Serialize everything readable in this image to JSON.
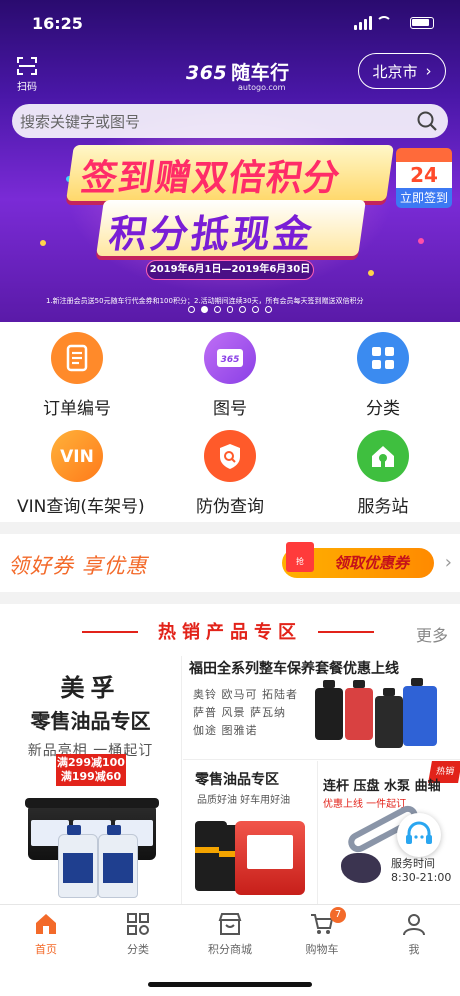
{
  "status_bar": {
    "time": "16:25"
  },
  "header": {
    "scan_label": "扫码",
    "logo_brand": "365",
    "logo_name": "随车行",
    "logo_domain": "autogo.com",
    "city": "北京市",
    "city_arrow": "›"
  },
  "search": {
    "placeholder": "搜索关键字或图号"
  },
  "banner": {
    "title_line1": "签到赠双倍积分",
    "title_line2": "积分抵现金",
    "calendar_day": "24",
    "calendar_button": "立即签到",
    "date_range": "2019年6月1日—2019年6月30日",
    "note": "1.新注册会员送50元随车行代金券和100积分；2.活动期间连续30天，所有会员每天签到赠送双倍积分",
    "pager_count": 7,
    "pager_active": 2
  },
  "quick_menu": {
    "items": [
      {
        "label": "订单编号",
        "icon": "order-icon"
      },
      {
        "label": "图号",
        "icon": "365-card-icon"
      },
      {
        "label": "分类",
        "icon": "grid-category-icon"
      },
      {
        "label": "VIN查询(车架号)",
        "icon": "vin-icon"
      },
      {
        "label": "防伪查询",
        "icon": "anti-fake-icon"
      },
      {
        "label": "服务站",
        "icon": "service-station-icon"
      }
    ],
    "vin_text": "VIN",
    "card_text": "365"
  },
  "coupon": {
    "title": "领好券 享优惠",
    "button": "领取优惠券",
    "bag_text": "抢",
    "arrow": "›"
  },
  "hot_zone": {
    "title": "热销产品专区",
    "more": "更多",
    "panel_oil": {
      "brand": "美孚",
      "title": "零售油品专区",
      "subtitle": "新品亮相 一桶起订",
      "promo_line1": "满299减100",
      "promo_line2": "满199减60"
    },
    "panel_futian": {
      "title": "福田全系列整车保养套餐优惠上线",
      "rows": [
        "奥铃 欧马可 拓陆者",
        "萨普 风景 萨瓦纳",
        "伽途 图雅诺"
      ]
    },
    "panel_retail": {
      "title": "零售油品专区",
      "subtitle": "品质好油 好车用好油"
    },
    "panel_parts": {
      "title": "连杆 压盘 水泵 曲轴",
      "subtitle": "优惠上线 一件起订",
      "tag": "热销",
      "service_text": "服务时间",
      "service_hours": "8:30-21:00"
    }
  },
  "tabbar": {
    "items": [
      {
        "label": "首页",
        "icon": "home-icon",
        "active": true
      },
      {
        "label": "分类",
        "icon": "category-icon",
        "active": false
      },
      {
        "label": "积分商城",
        "icon": "points-mall-icon",
        "active": false
      },
      {
        "label": "购物车",
        "icon": "cart-icon",
        "active": false
      },
      {
        "label": "我",
        "icon": "profile-icon",
        "active": false
      }
    ],
    "cart_badge": "7"
  },
  "colors": {
    "accent": "#f36a2a",
    "red": "#e2231a",
    "banner_purple": "#5a1aa8"
  }
}
